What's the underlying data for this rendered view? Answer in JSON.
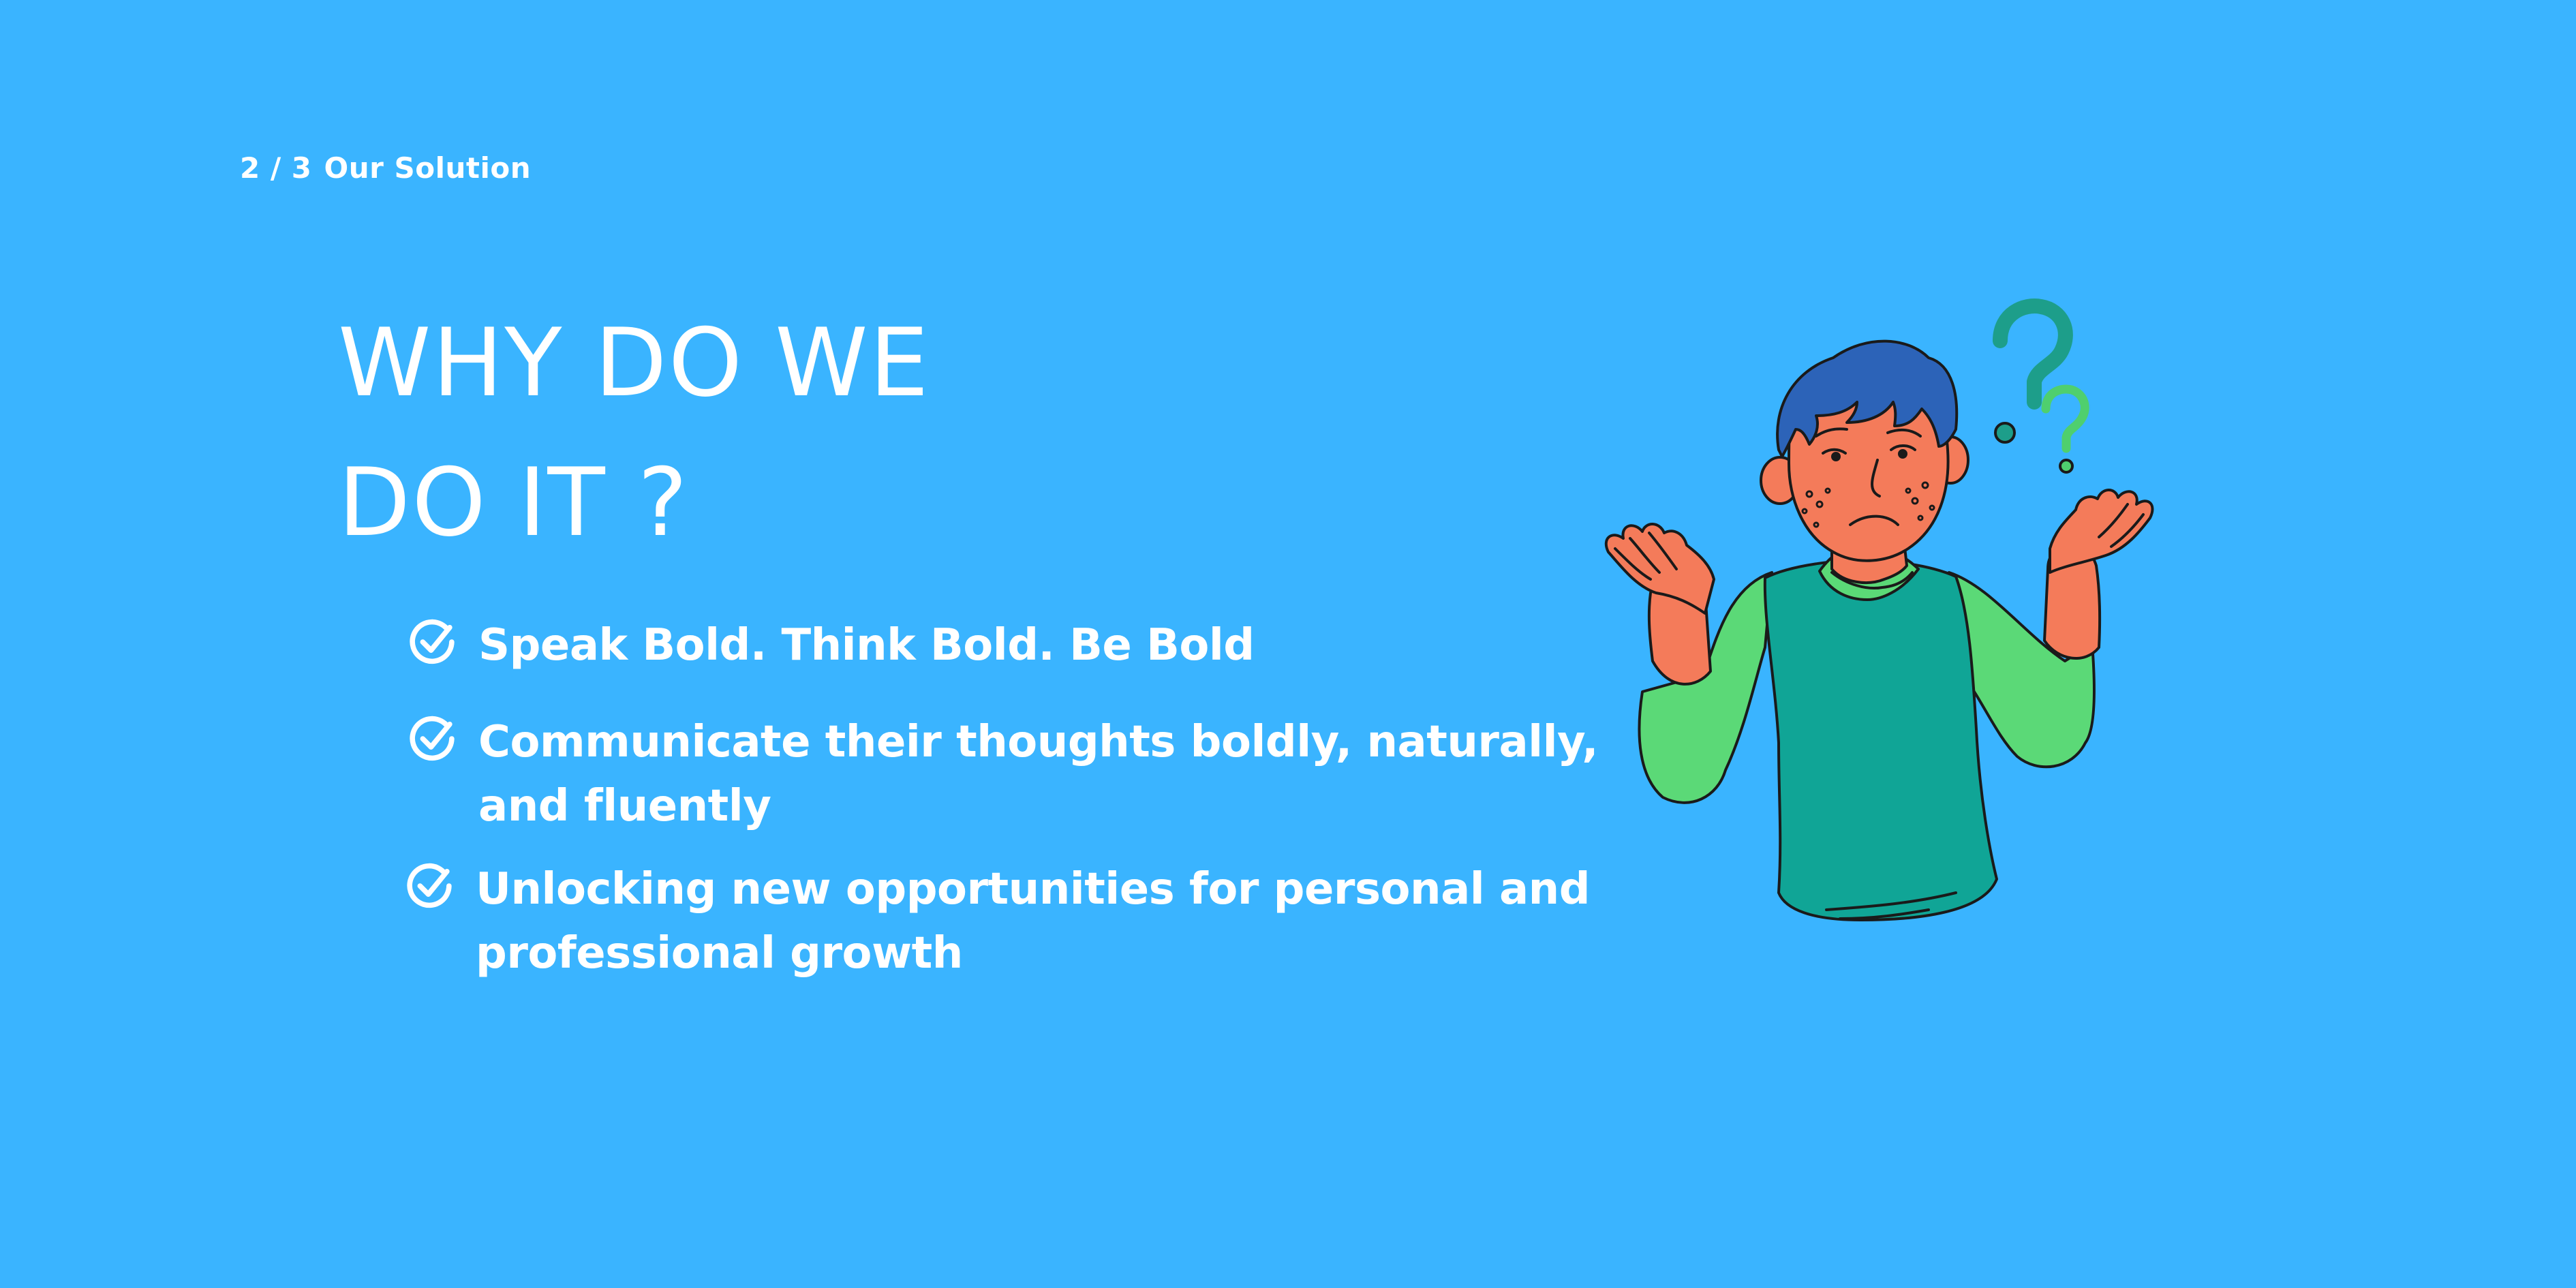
{
  "slide": {
    "indicator_page": "2 / 3",
    "indicator_section": "Our Solution"
  },
  "title": {
    "line1": "WHY DO WE",
    "line2": "DO IT ?"
  },
  "bullets": [
    {
      "text": "Speak Bold. Think Bold. Be Bold"
    },
    {
      "line1": "Communicate their thoughts boldly, naturally,",
      "line2": "and fluently"
    },
    {
      "line1": "Unlocking new opportunities for personal and",
      "line2": "professional growth"
    }
  ],
  "icons": {
    "bullet": "check-circle-icon",
    "illustration": "confused-person-shrugging"
  },
  "colors": {
    "background": "#3AB4FF",
    "text": "#FFFFFF",
    "skin": "#F47B5A",
    "hair": "#2C63B8",
    "shirt_body": "#10A596",
    "shirt_sleeves": "#5BD977",
    "question_dark": "#1D9E8A",
    "question_light": "#4FCF6E"
  }
}
